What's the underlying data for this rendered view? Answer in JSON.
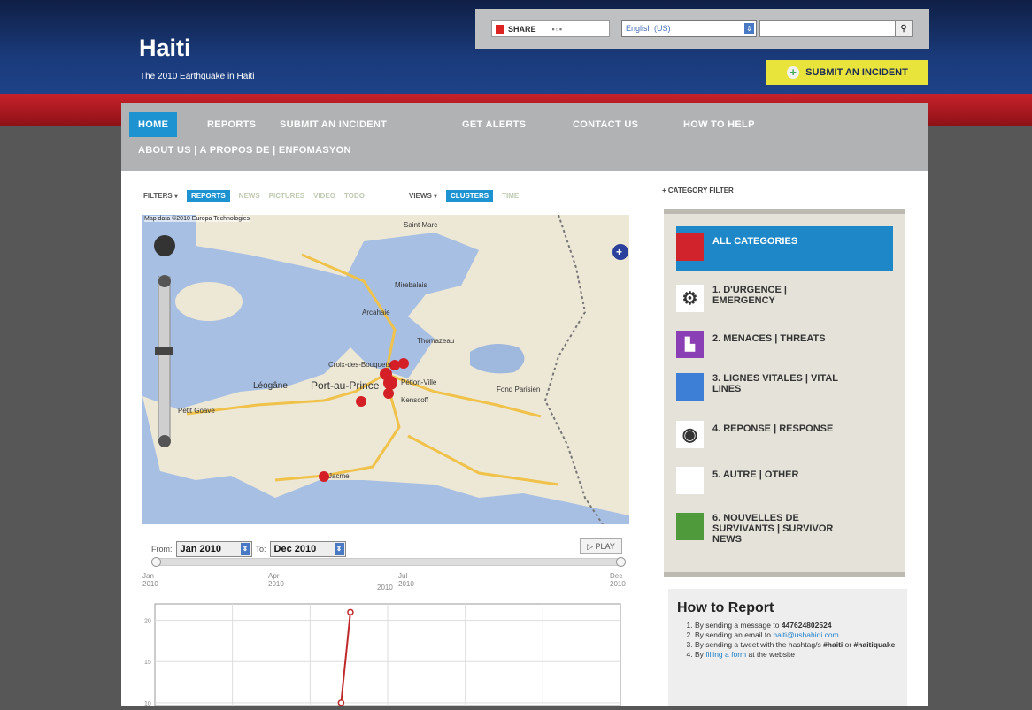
{
  "header": {
    "share_label": "SHARE",
    "language": "English (US)",
    "search_placeholder": "",
    "site_title": "Haiti",
    "tagline": "The 2010 Earthquake in Haiti",
    "submit_incident": "SUBMIT AN INCIDENT"
  },
  "nav": {
    "items": [
      "HOME",
      "REPORTS",
      "SUBMIT AN INCIDENT",
      "GET ALERTS",
      "CONTACT US",
      "HOW TO HELP"
    ],
    "second_row": "ABOUT US | A PROPOS DE | ENFOMASYON"
  },
  "filters": {
    "label": "FILTERS",
    "options": [
      "REPORTS",
      "NEWS",
      "PICTURES",
      "VIDEO",
      "TODO"
    ],
    "views_label": "VIEWS",
    "views": [
      "CLUSTERS",
      "TIME"
    ]
  },
  "map": {
    "attribution": "Map data ©2010 Europa Technologies",
    "places": [
      "Port-au-Prince",
      "Léogâne",
      "Croix-des-Bouquets",
      "Jacmel",
      "Petit Goave",
      "Mirebalais",
      "Saint Marc",
      "Kenscoff",
      "Pétion-Ville",
      "Arcahaie",
      "Thomazeau",
      "Fond Parisien"
    ]
  },
  "timeline": {
    "from_label": "From:",
    "from_value": "Jan 2010",
    "to_label": "To:",
    "to_value": "Dec 2010",
    "play_label": "PLAY",
    "ticks": [
      {
        "month": "Jan",
        "year": "2010"
      },
      {
        "month": "Apr",
        "year": "2010"
      },
      {
        "month": "Jul",
        "year": "2010"
      },
      {
        "month": "Dec",
        "year": "2010"
      }
    ],
    "mid_year": "2010"
  },
  "chart_data": {
    "type": "line",
    "y_ticks": [
      20,
      15,
      10
    ],
    "ylim": [
      0,
      22
    ],
    "x": [
      0.4,
      0.42
    ],
    "values": [
      10,
      21
    ],
    "line_color": "#c0292b"
  },
  "categories": {
    "header": "+ CATEGORY FILTER",
    "items": [
      {
        "label": "ALL CATEGORIES",
        "color": "#d0232b",
        "icon": "square"
      },
      {
        "label": "1. D'URGENCE | EMERGENCY",
        "color": "#ffffff",
        "icon": "gear-icon"
      },
      {
        "label": "2. MENACES | THREATS",
        "color": "#8b3fb4",
        "icon": "chart-icon"
      },
      {
        "label": "3. LIGNES VITALES | VITAL LINES",
        "color": "#3d7fd6",
        "icon": "square"
      },
      {
        "label": "4. REPONSE | RESPONSE",
        "color": "#ffffff",
        "icon": "response-icon"
      },
      {
        "label": "5. AUTRE | OTHER",
        "color": "#ffffff",
        "icon": "square"
      },
      {
        "label": "6. NOUVELLES DE SURVIVANTS | SURVIVOR NEWS",
        "color": "#4f9a3a",
        "icon": "square"
      }
    ]
  },
  "howto": {
    "title": "How to Report",
    "step1_prefix": "By sending a message to ",
    "step1_number": "447624802524",
    "step2_prefix": "By sending an email to ",
    "step2_email": "haiti@ushahidi.com",
    "step3_prefix": "By sending a tweet with the hashtag/s ",
    "step3_tag1": "#haiti",
    "step3_mid": " or ",
    "step3_tag2": "#haitiquake",
    "step4_prefix": "By ",
    "step4_link": "filling a form",
    "step4_suffix": " at the website"
  }
}
